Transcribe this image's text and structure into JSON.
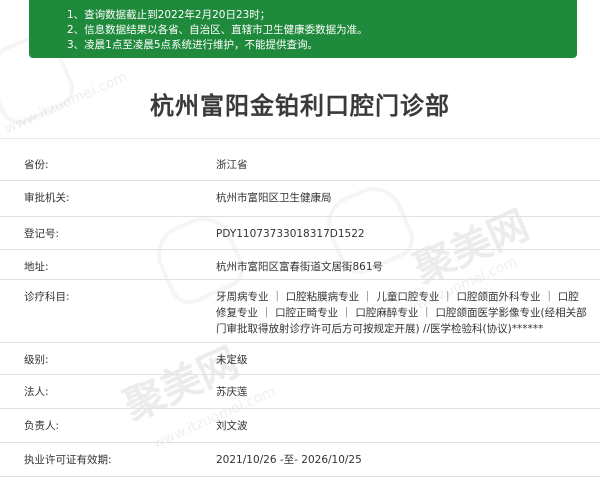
{
  "notice": {
    "line1": "1、查询数据截止到2022年2月20日23时；",
    "line2": "2、信息数据结果以各省、自治区、直辖市卫生健康委数据为准。",
    "line3": "3、凌晨1点至凌晨5点系统进行维护，不能提供查询。"
  },
  "title": "杭州富阳金铂利口腔门诊部",
  "rows": [
    {
      "label": "省份:",
      "value": "浙江省"
    },
    {
      "label": "审批机关:",
      "value": "杭州市富阳区卫生健康局"
    },
    {
      "label": "登记号:",
      "value": "PDY11073733018317D1522"
    },
    {
      "label": "地址:",
      "value": "杭州市富阳区富春街道文居街861号"
    },
    {
      "label": "诊疗科目:",
      "value": "牙周病专业 ｜ 口腔粘膜病专业 ｜ 儿童口腔专业 ｜ 口腔颌面外科专业 ｜ 口腔修复专业 ｜ 口腔正畸专业 ｜ 口腔麻醉专业 ｜ 口腔颌面医学影像专业(经相关部门审批取得放射诊疗许可后方可按规定开展) //医学检验科(协议)******"
    },
    {
      "label": "级别:",
      "value": "未定级"
    },
    {
      "label": "法人:",
      "value": "苏庆莲"
    },
    {
      "label": "负责人:",
      "value": "刘文波"
    },
    {
      "label": "执业许可证有效期:",
      "value": "2021/10/26 -至- 2026/10/25"
    }
  ],
  "watermark": {
    "brand": "聚美网",
    "site": "www.itzuomei.com"
  },
  "colors": {
    "notice_bg": "#1f8a3c",
    "notice_text": "#ffffff",
    "title": "#3a3a3a",
    "divider": "#e2e2e2"
  }
}
